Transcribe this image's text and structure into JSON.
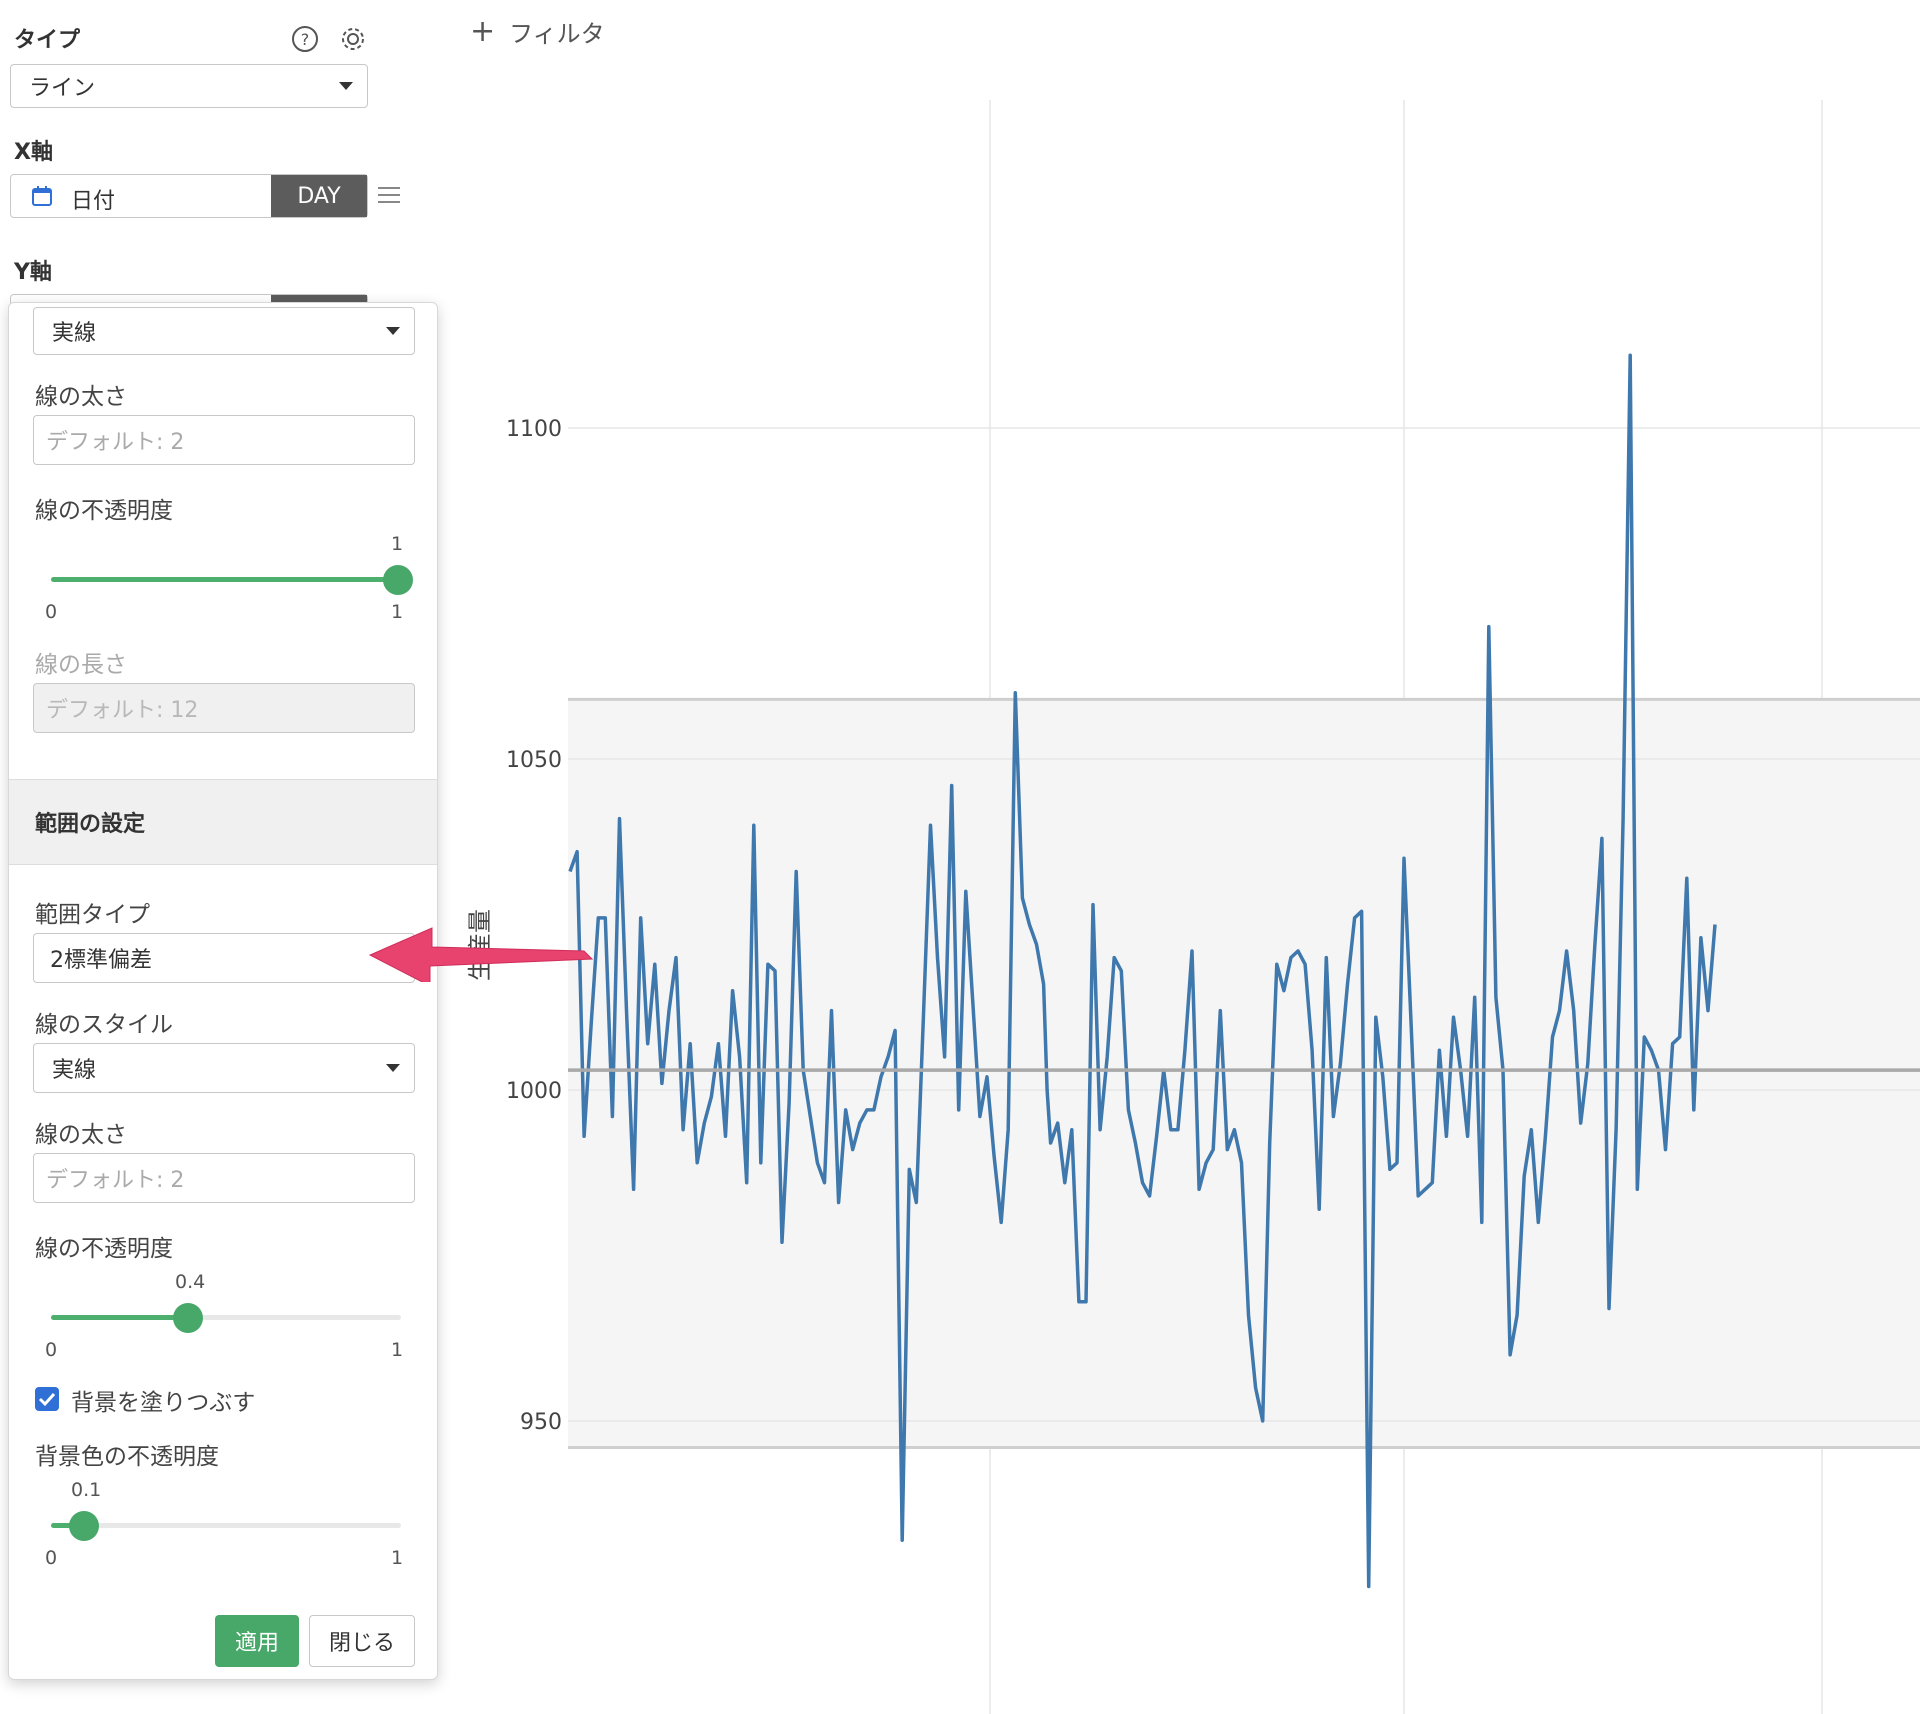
{
  "sidebar": {
    "type_label": "タイプ",
    "type_value": "ライン",
    "x_axis_label": "X軸",
    "x_field_value": "日付",
    "x_unit_button": "DAY",
    "y_axis_label": "Y軸"
  },
  "filter": {
    "label": "フィルタ"
  },
  "panel": {
    "line_style_value": "実線",
    "line_width_label": "線の太さ",
    "line_width_placeholder": "デフォルト: 2",
    "line_opacity_label": "線の不透明度",
    "line_opacity_value": "1",
    "line_opacity_min": "0",
    "line_opacity_max": "1",
    "line_length_label": "線の長さ",
    "line_length_placeholder": "デフォルト: 12",
    "range_section_title": "範囲の設定",
    "range_type_label": "範囲タイプ",
    "range_type_value": "2標準偏差",
    "range_line_style_label": "線のスタイル",
    "range_line_style_value": "実線",
    "range_line_width_label": "線の太さ",
    "range_line_width_placeholder": "デフォルト: 2",
    "range_line_opacity_label": "線の不透明度",
    "range_line_opacity_value": "0.4",
    "range_line_opacity_min": "0",
    "range_line_opacity_max": "1",
    "fill_background_label": "背景を塗りつぶす",
    "fill_background_checked": true,
    "bg_opacity_label": "背景色の不透明度",
    "bg_opacity_value": "0.1",
    "bg_opacity_min": "0",
    "bg_opacity_max": "1",
    "apply_button": "適用",
    "close_button": "閉じる"
  },
  "colors": {
    "accent_green": "#48a86a",
    "line_blue": "#3f78ad",
    "arrow_pink": "#e8426e",
    "dark_button": "#5c5c5c",
    "checkbox_blue": "#2f6fd6"
  },
  "chart_data": {
    "type": "line",
    "ylabel": "生産量",
    "yticks": [
      950,
      1000,
      1050,
      1100
    ],
    "ylim": [
      925,
      1110
    ],
    "mean": 1003,
    "band_upper": 1059,
    "band_lower": 946,
    "x": [
      0,
      1,
      2,
      3,
      4,
      5,
      6,
      7,
      8,
      9,
      10,
      11,
      12,
      13,
      14,
      15,
      16,
      17,
      18,
      19,
      20,
      21,
      22,
      23,
      24,
      25,
      26,
      27,
      28,
      29,
      30,
      31,
      32,
      33,
      34,
      35,
      36,
      37,
      38,
      39,
      40,
      41,
      42,
      43,
      44,
      45,
      46,
      47,
      48,
      49,
      50,
      51,
      52,
      53,
      54,
      55,
      56,
      57,
      58,
      59,
      60,
      61,
      62,
      63,
      64,
      65,
      66,
      67,
      67.5,
      68,
      69,
      70,
      71,
      72,
      73,
      74,
      75,
      76,
      77,
      78,
      79,
      80,
      81,
      82,
      83,
      84,
      85,
      86,
      87,
      88,
      89,
      90,
      91,
      92,
      93,
      94,
      95,
      96,
      97,
      98,
      99,
      100,
      101,
      102,
      103,
      104,
      105,
      106,
      107,
      108,
      109,
      110,
      111,
      112,
      113,
      114,
      115,
      116,
      117,
      118,
      119,
      120,
      121,
      122,
      123,
      124,
      125,
      126,
      127,
      128,
      129,
      130,
      131,
      132,
      133,
      134,
      135,
      136,
      137,
      138,
      139,
      140,
      141,
      142,
      143,
      144,
      145,
      146,
      147,
      148,
      149,
      150,
      151,
      152,
      153,
      154,
      155,
      156,
      157,
      158,
      159,
      160,
      161,
      162,
      163,
      164,
      165,
      166,
      167,
      168,
      169,
      170,
      171,
      172,
      173,
      174,
      175,
      176,
      177,
      178,
      179,
      180,
      181,
      182,
      183,
      184,
      185,
      186,
      187,
      188,
      189,
      190,
      191
    ],
    "values": [
      1033,
      1036,
      993,
      1010,
      1026,
      1026,
      996,
      1041,
      1012,
      985,
      1026,
      1007,
      1019,
      1001,
      1012,
      1020,
      994,
      1007,
      989,
      995,
      999,
      1007,
      993,
      1015,
      1005,
      986,
      1040,
      989,
      1019,
      1018,
      977,
      998,
      1033,
      1003,
      996,
      989,
      986,
      1012,
      983,
      997,
      991,
      995,
      997,
      997,
      1002,
      1005,
      1009,
      932,
      988,
      983,
      1011,
      1040,
      1020,
      1005,
      1046,
      997,
      1030,
      1013,
      996,
      1002,
      990,
      980,
      994,
      1060,
      1029,
      1025,
      1022,
      1016,
      1000,
      992,
      995,
      986,
      994,
      968,
      968,
      1028,
      994,
      1005,
      1020,
      1018,
      997,
      992,
      986,
      984,
      993,
      1003,
      994,
      994,
      1006,
      1021,
      985,
      989,
      991,
      1012,
      991,
      994,
      989,
      966,
      955,
      950,
      992,
      1019,
      1015,
      1020,
      1021,
      1019,
      1006,
      982,
      1020,
      996,
      1004,
      1016,
      1026,
      1027,
      925,
      1011,
      1002,
      988,
      989,
      1035,
      1010,
      984,
      985,
      986,
      1006,
      993,
      1011,
      1003,
      993,
      1014,
      980,
      1070,
      1014,
      1003,
      960,
      966,
      987,
      994,
      980,
      993,
      1008,
      1012,
      1021,
      1012,
      995,
      1004,
      1022,
      1038,
      967,
      994,
      1041,
      1111,
      985,
      1008,
      1006,
      1003,
      991,
      1007,
      1008,
      1032,
      997,
      1023,
      1012,
      1025
    ]
  }
}
